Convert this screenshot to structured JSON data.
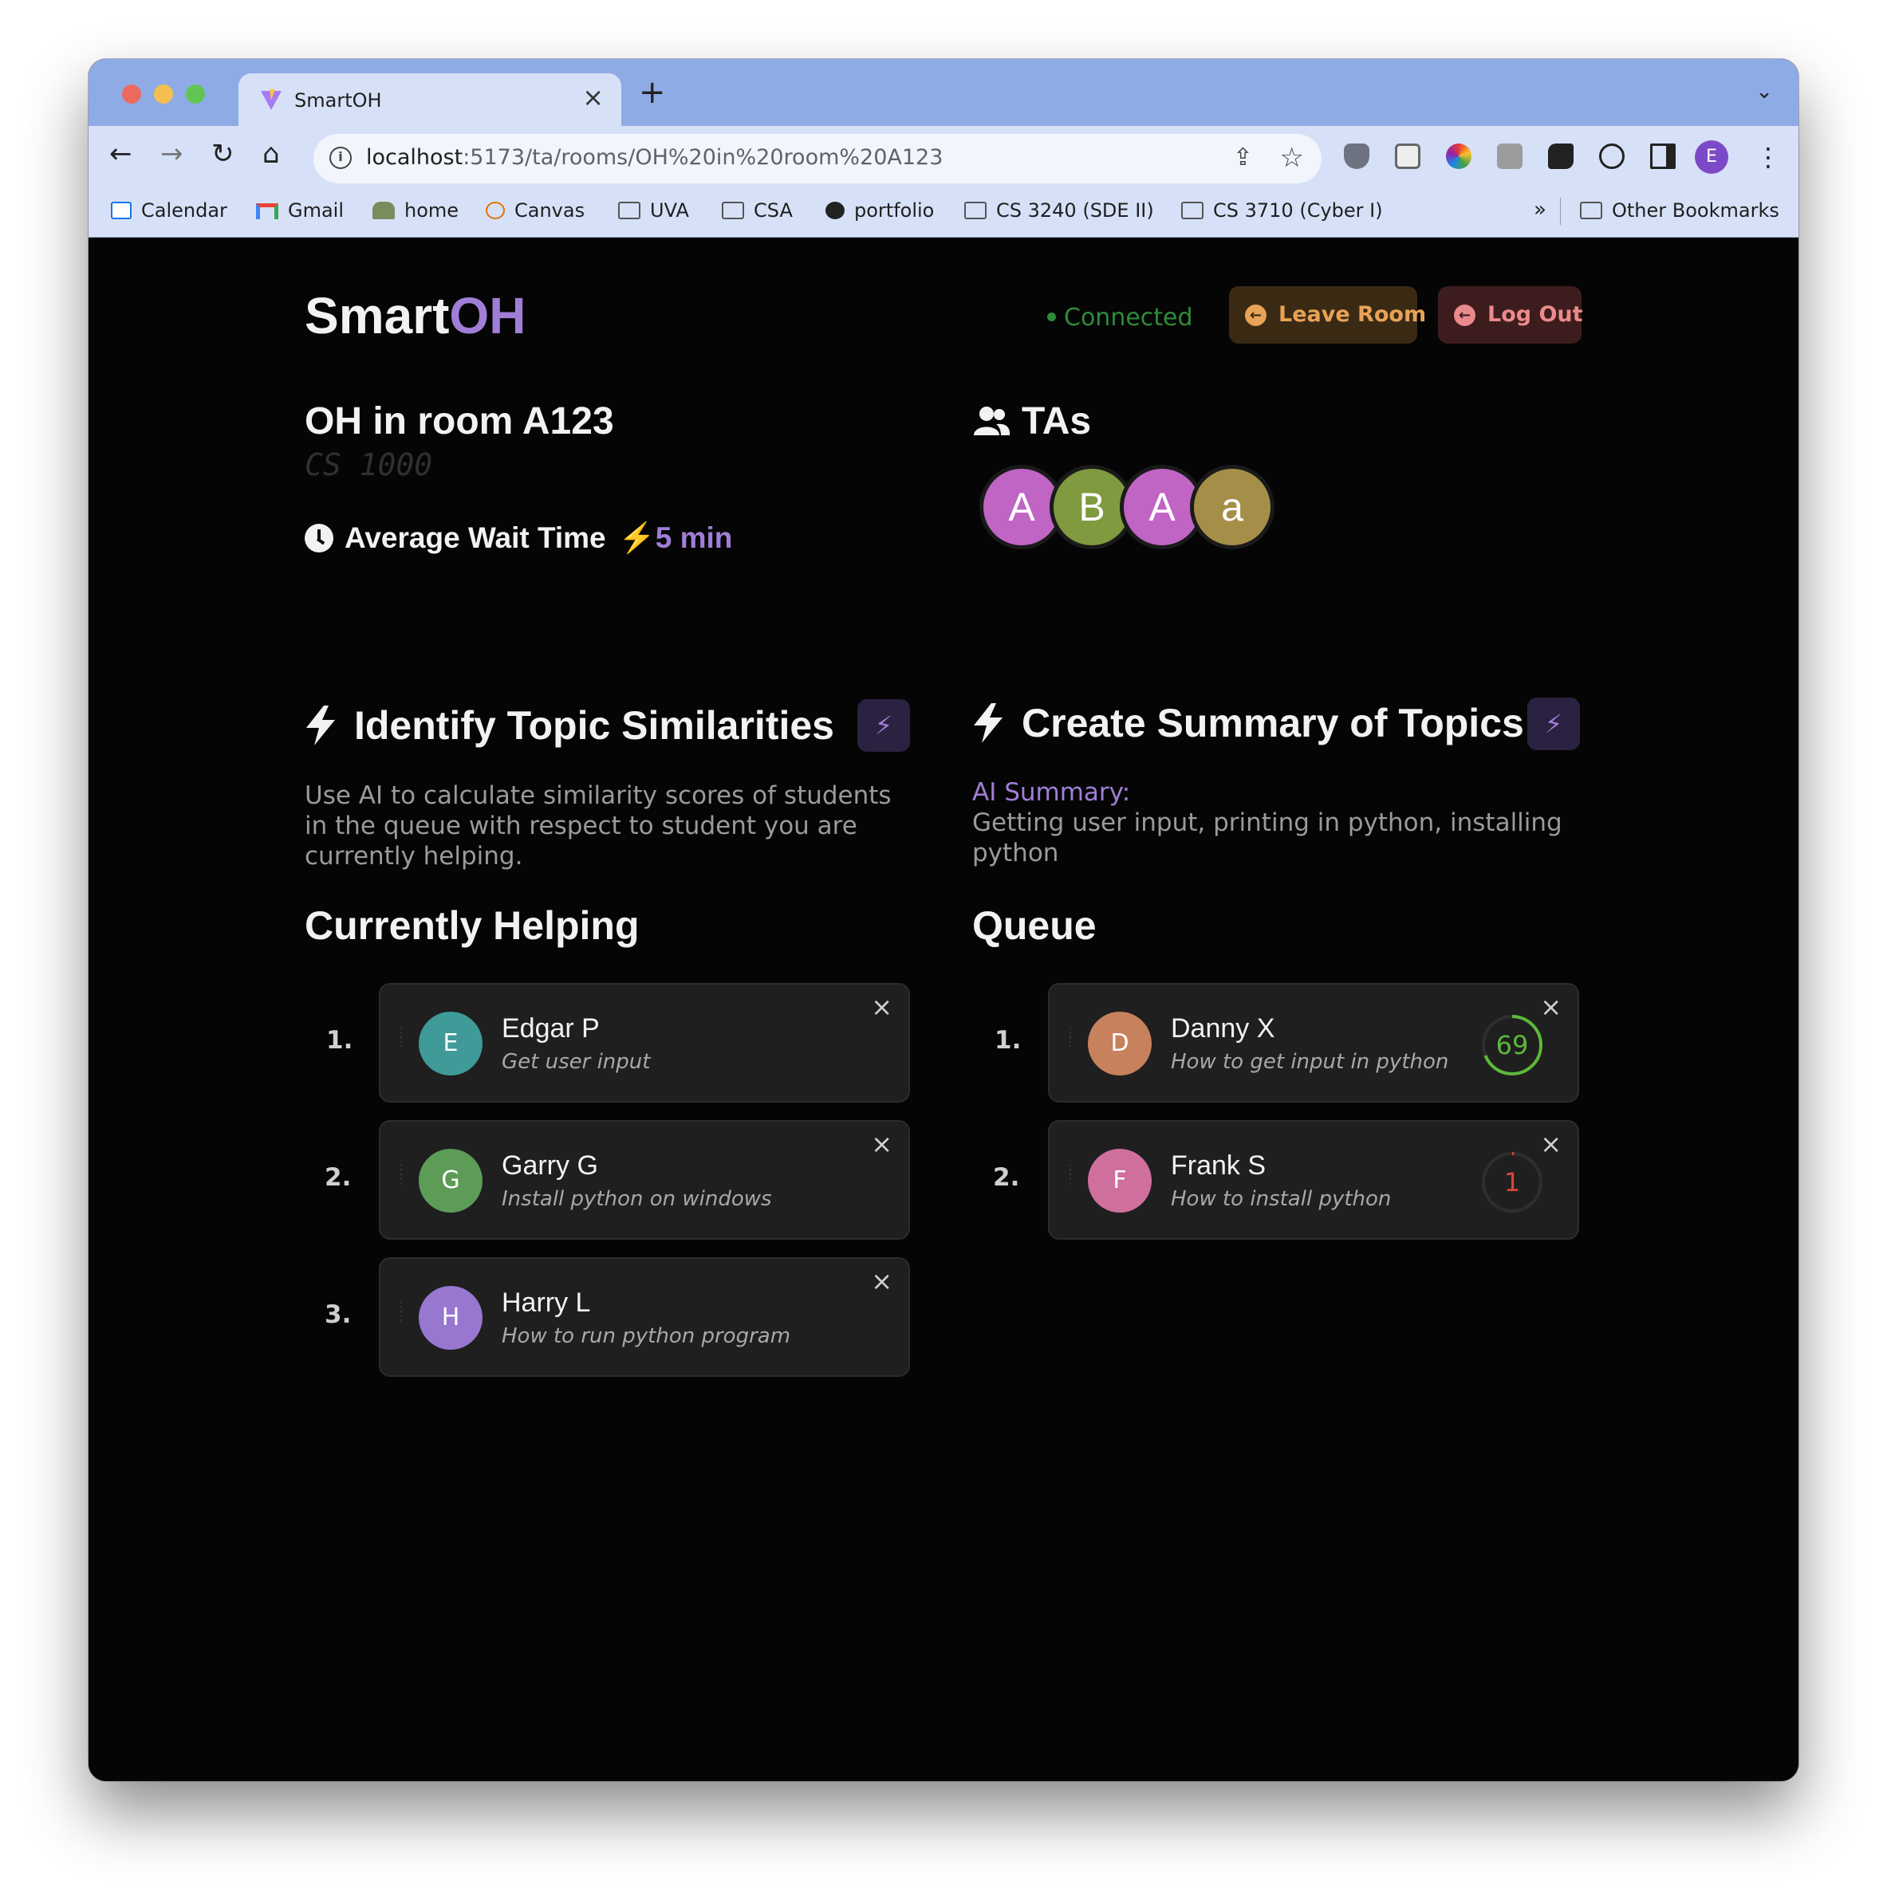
{
  "browser": {
    "tab_title": "SmartOH",
    "url_host": "localhost",
    "url_path": ":5173/ta/rooms/OH%20in%20room%20A123",
    "profile_initial": "E",
    "bookmarks": [
      "Calendar",
      "Gmail",
      "home",
      "Canvas",
      "UVA",
      "CSA",
      "portfolio",
      "CS 3240 (SDE II)",
      "CS 3710 (Cyber I)"
    ],
    "bookmarks_more": "»",
    "other_bookmarks": "Other Bookmarks"
  },
  "header": {
    "brand_main": "Smart",
    "brand_accent": "OH",
    "status": "Connected",
    "leave_label": "Leave Room",
    "logout_label": "Log Out"
  },
  "room": {
    "title": "OH in room A123",
    "course": "CS 1000",
    "wait_label": "Average Wait Time",
    "wait_value": "⚡5 min"
  },
  "tas": {
    "title": "TAs",
    "avatars": [
      {
        "initial": "A",
        "color": "#c065c4"
      },
      {
        "initial": "B",
        "color": "#7f9a3f"
      },
      {
        "initial": "A",
        "color": "#c065c4"
      },
      {
        "initial": "a",
        "color": "#a58f48"
      }
    ]
  },
  "similarities": {
    "title": "Identify Topic Similarities",
    "description": "Use AI to calculate similarity scores of students in the queue with respect to student you are currently helping."
  },
  "summary": {
    "title": "Create Summary of Topics",
    "label": "AI Summary:",
    "text": "Getting user input, printing in python, installing python"
  },
  "helping": {
    "title": "Currently Helping",
    "items": [
      {
        "num": "1.",
        "initial": "E",
        "name": "Edgar P",
        "topic": "Get user input",
        "color": "#3f9a98"
      },
      {
        "num": "2.",
        "initial": "G",
        "name": "Garry G",
        "topic": "Install python on windows",
        "color": "#5c9c57"
      },
      {
        "num": "3.",
        "initial": "H",
        "name": "Harry L",
        "topic": "How to run python program",
        "color": "#9777d0"
      }
    ]
  },
  "queue": {
    "title": "Queue",
    "items": [
      {
        "num": "1.",
        "initial": "D",
        "name": "Danny X",
        "topic": "How to get input in python",
        "color": "#c7815d",
        "score": "69",
        "score_fraction": 0.69,
        "score_color": "#5cb83a"
      },
      {
        "num": "2.",
        "initial": "F",
        "name": "Frank S",
        "topic": "How to install python",
        "color": "#cf6f9e",
        "score": "1",
        "score_fraction": 0.01,
        "score_color": "#e0443a"
      }
    ]
  },
  "colors": {
    "accent": "#a07ed6",
    "connected": "#2f8a3a",
    "leave": "#e8a356",
    "logout": "#ea8a8b"
  }
}
